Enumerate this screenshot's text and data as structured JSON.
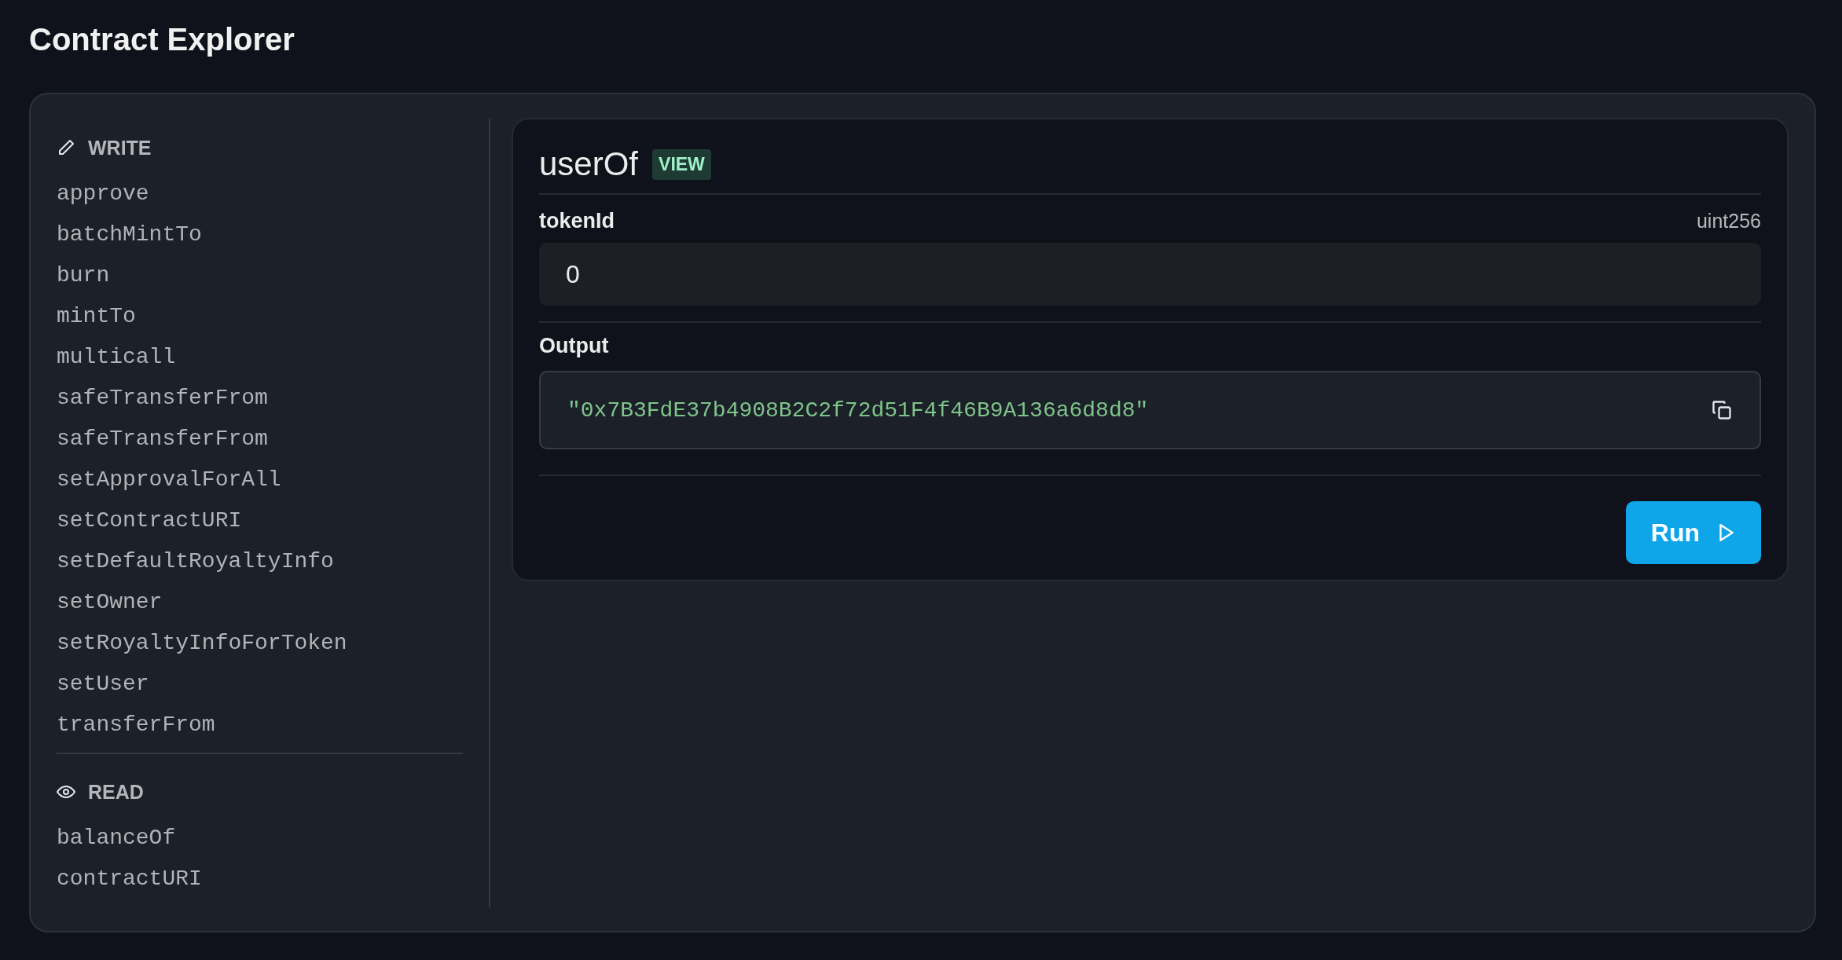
{
  "title": "Contract Explorer",
  "sections": [
    {
      "kind": "write",
      "label": "WRITE",
      "items": [
        "approve",
        "batchMintTo",
        "burn",
        "mintTo",
        "multicall",
        "safeTransferFrom",
        "safeTransferFrom",
        "setApprovalForAll",
        "setContractURI",
        "setDefaultRoyaltyInfo",
        "setOwner",
        "setRoyaltyInfoForToken",
        "setUser",
        "transferFrom"
      ]
    },
    {
      "kind": "read",
      "label": "READ",
      "items": [
        "balanceOf",
        "contractURI"
      ]
    }
  ],
  "function": {
    "name": "userOf",
    "badge": "VIEW",
    "inputs": [
      {
        "name": "tokenId",
        "type": "uint256",
        "value": "0"
      }
    ],
    "output": {
      "label": "Output",
      "value": "\"0x7B3FdE37b4908B2C2f72d51F4f46B9A136a6d8d8\""
    },
    "run_button": "Run"
  }
}
